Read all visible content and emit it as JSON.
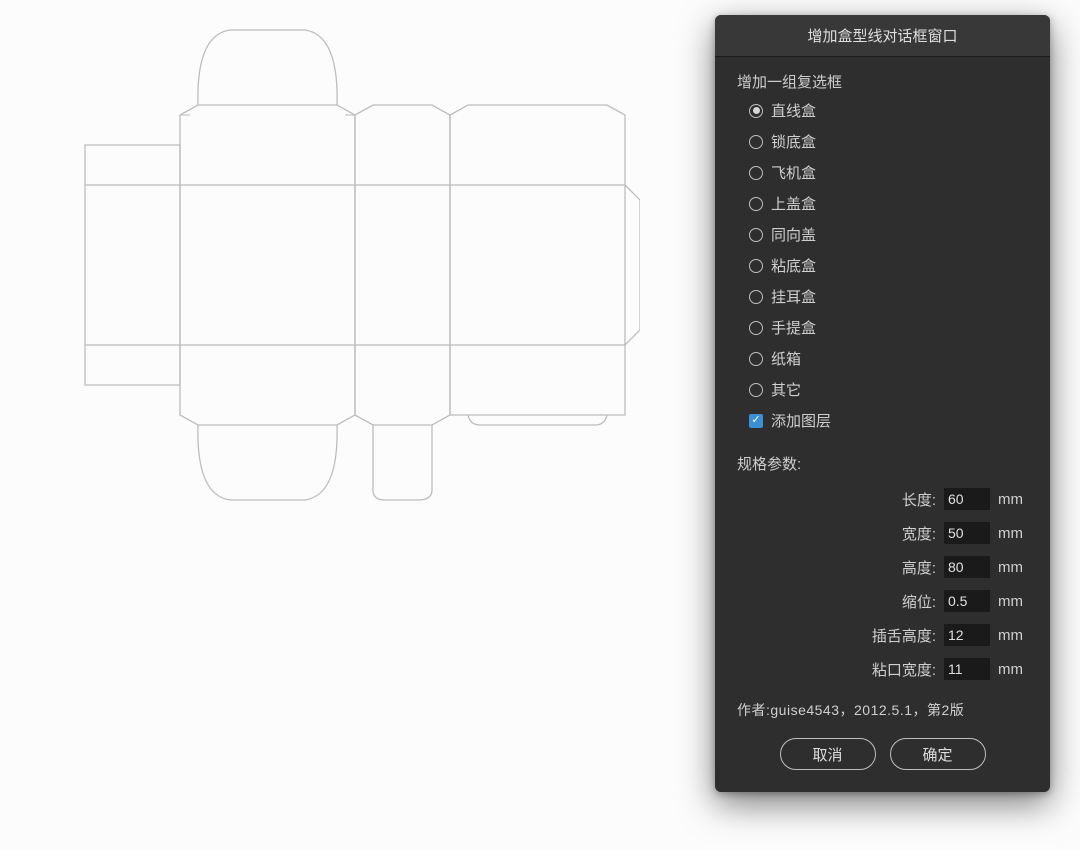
{
  "dialog": {
    "title": "增加盒型线对话框窗口",
    "group_label": "增加一组复选框",
    "radios": [
      {
        "label": "直线盒",
        "checked": true
      },
      {
        "label": "锁底盒",
        "checked": false
      },
      {
        "label": "飞机盒",
        "checked": false
      },
      {
        "label": "上盖盒",
        "checked": false
      },
      {
        "label": "同向盖",
        "checked": false
      },
      {
        "label": "粘底盒",
        "checked": false
      },
      {
        "label": "挂耳盒",
        "checked": false
      },
      {
        "label": "手提盒",
        "checked": false
      },
      {
        "label": "纸箱",
        "checked": false
      },
      {
        "label": "其它",
        "checked": false
      }
    ],
    "checkbox": {
      "label": "添加图层",
      "checked": true
    },
    "params_title": "规格参数:",
    "params": [
      {
        "label": "长度:",
        "value": "60",
        "unit": "mm"
      },
      {
        "label": "宽度:",
        "value": "50",
        "unit": "mm"
      },
      {
        "label": "高度:",
        "value": "80",
        "unit": "mm"
      },
      {
        "label": "缩位:",
        "value": "0.5",
        "unit": "mm"
      },
      {
        "label": "插舌高度:",
        "value": "12",
        "unit": "mm"
      },
      {
        "label": "粘口宽度:",
        "value": "11",
        "unit": "mm"
      }
    ],
    "author_line": "作者:guise4543，2012.5.1，第2版",
    "cancel_label": "取消",
    "confirm_label": "确定"
  }
}
